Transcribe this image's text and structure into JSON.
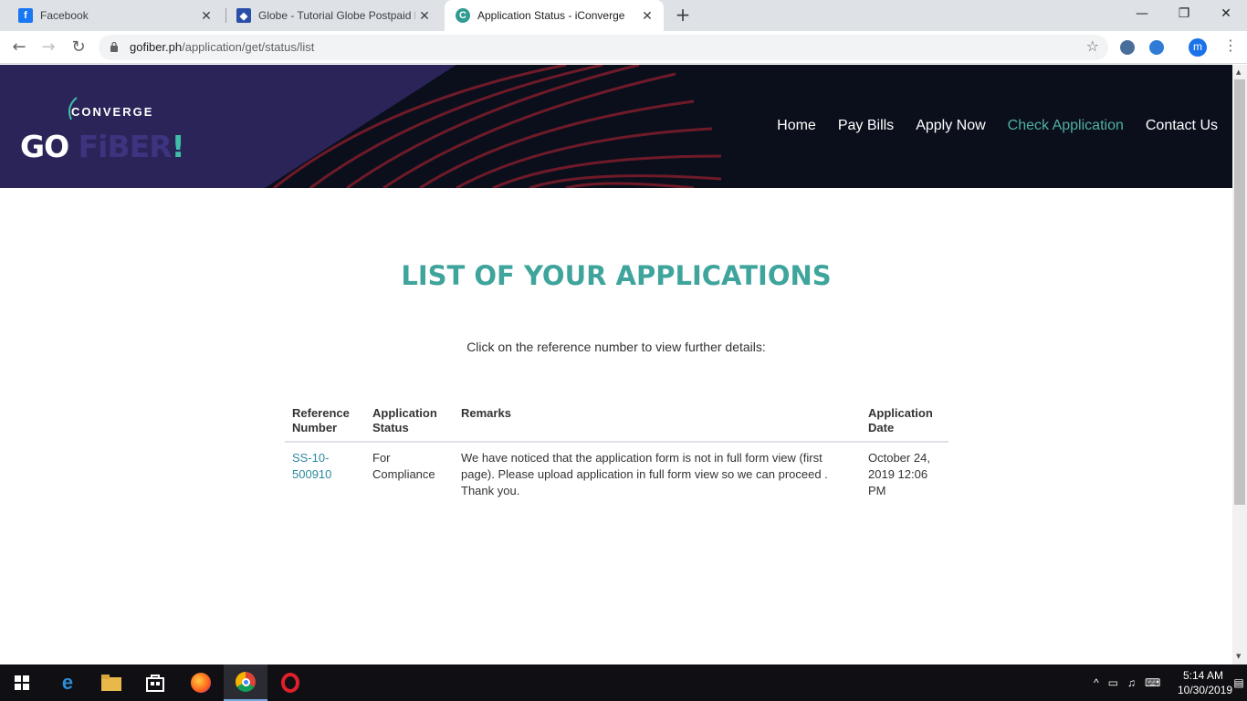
{
  "browser": {
    "tabs": [
      {
        "title": "Facebook",
        "favicon": "facebook-icon",
        "color": "#1877f2",
        "active": false
      },
      {
        "title": "Globe - Tutorial Globe Postpaid L",
        "favicon": "globe-icon",
        "color": "#2a4fa8",
        "active": false
      },
      {
        "title": "Application Status - iConverge",
        "favicon": "converge-icon",
        "color": "#2f9c92",
        "active": true
      }
    ],
    "url_domain": "gofiber.ph",
    "url_path": "/application/get/status/list",
    "profile_initial": "m"
  },
  "site": {
    "logo_top": "CONVERGE",
    "logo_go": "GO",
    "logo_fiber": "FiBER",
    "logo_bang": "!",
    "nav": [
      {
        "label": "Home",
        "active": false
      },
      {
        "label": "Pay Bills",
        "active": false
      },
      {
        "label": "Apply Now",
        "active": false
      },
      {
        "label": "Check Application",
        "active": true
      },
      {
        "label": "Contact Us",
        "active": false
      }
    ],
    "accent": "#3fa59c"
  },
  "main": {
    "heading": "LIST OF YOUR APPLICATIONS",
    "subtext": "Click on the reference number to view further details:",
    "table": {
      "headers": [
        "Reference Number",
        "Application Status",
        "Remarks",
        "Application Date"
      ],
      "rows": [
        {
          "reference": "SS-10-500910",
          "status": "For Compliance",
          "remarks": "We have noticed that the application form is not in full form view (first page). Please upload application in full form view so we can proceed . Thank you.",
          "date": "October 24, 2019 12:06 PM"
        }
      ]
    }
  },
  "taskbar": {
    "time": "5:14 AM",
    "date": "10/30/2019"
  }
}
